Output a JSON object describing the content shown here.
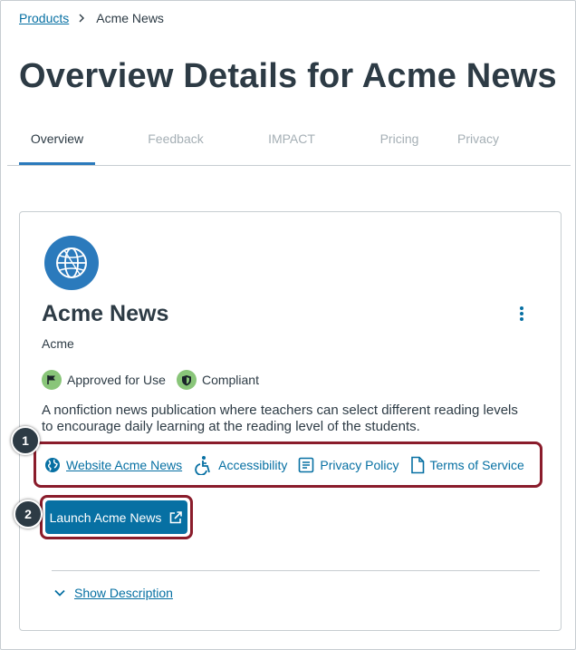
{
  "breadcrumb": {
    "root_label": "Products",
    "current_label": "Acme News"
  },
  "page": {
    "title": "Overview Details for Acme News"
  },
  "tabs": [
    {
      "label": "Overview",
      "active": true
    },
    {
      "label": "Feedback",
      "active": false
    },
    {
      "label": "IMPACT",
      "active": false
    },
    {
      "label": "Pricing",
      "active": false
    },
    {
      "label": "Privacy",
      "active": false
    }
  ],
  "product": {
    "name": "Acme News",
    "company": "Acme",
    "badges": [
      {
        "label": "Approved for Use",
        "icon": "flag-icon"
      },
      {
        "label": "Compliant",
        "icon": "shield-icon"
      }
    ],
    "description": "A nonfiction news publication where teachers can select different reading levels to encourage daily learning at the reading level of the students."
  },
  "links": [
    {
      "label": "Website Acme News",
      "icon": "globe-icon"
    },
    {
      "label": "Accessibility",
      "icon": "accessibility-icon"
    },
    {
      "label": "Privacy Policy",
      "icon": "document-icon"
    },
    {
      "label": "Terms of Service",
      "icon": "file-icon"
    }
  ],
  "launch": {
    "label": "Launch Acme News",
    "icon": "external-link-icon"
  },
  "callouts": {
    "links": "1",
    "launch": "2"
  },
  "show_description": {
    "label": "Show Description"
  },
  "colors": {
    "link": "#0770a3",
    "primary_button": "#0770a3",
    "highlight_border": "#8a1c2b",
    "badge_green": "#89c579",
    "tab_indicator": "#2b7abc",
    "text": "#2d3b45"
  }
}
